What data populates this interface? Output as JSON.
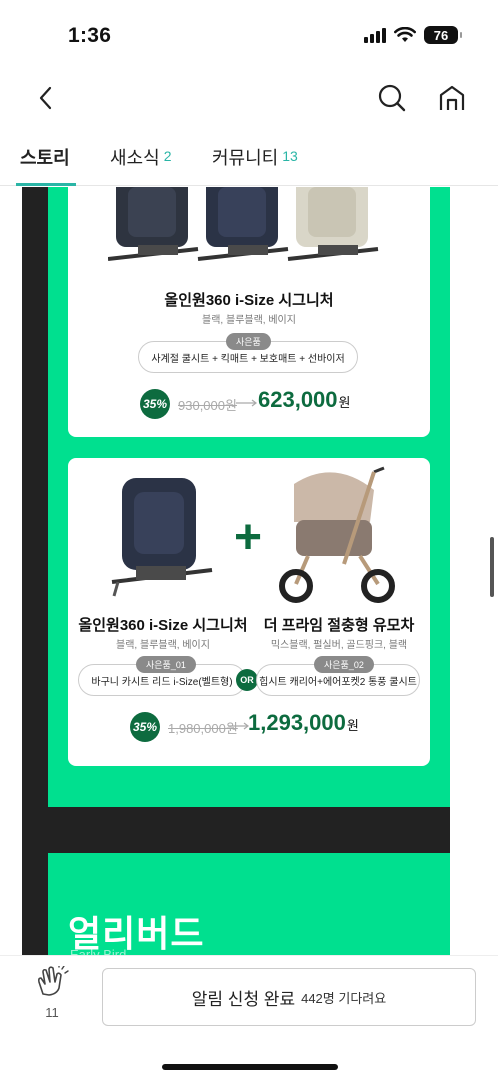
{
  "status_bar": {
    "time": "1:36",
    "battery": "76"
  },
  "nav": {
    "back_icon": "chevron-left-icon",
    "search_icon": "search-icon",
    "home_icon": "home-icon"
  },
  "tabs": [
    {
      "label": "스토리",
      "count": ""
    },
    {
      "label": "새소식",
      "count": "2"
    },
    {
      "label": "커뮤니티",
      "count": "13"
    }
  ],
  "card1": {
    "title": "올인원360 i-Size 시그니처",
    "colors": "블랙, 블루블랙, 베이지",
    "gift_tag": "사은품",
    "gift": "사계절 쿨시트 + 킥매트 + 보호매트 + 선바이저",
    "discount": "35%",
    "original_price": "930,000원",
    "sale_price": "623,000",
    "won": "원"
  },
  "card2": {
    "left_title": "올인원360 i-Size 시그니처",
    "left_colors": "블랙, 블루블랙, 베이지",
    "right_title": "더 프라임 절충형 유모차",
    "right_colors": "믹스블랙, 펄실버, 골드핑크, 블랙",
    "gift1_tag": "사은품_01",
    "gift1": "바구니 카시트 리드 i-Size(벨트형)",
    "or_label": "OR",
    "gift2_tag": "사은품_02",
    "gift2": "힙시트 캐리어+에어포켓2 통풍 쿨시트",
    "discount": "35%",
    "original_price": "1,980,000원",
    "sale_price": "1,293,000",
    "won": "원",
    "plus": "+"
  },
  "early_bird": {
    "title": "얼리버드",
    "subtitle": "Early Bird"
  },
  "bottom": {
    "clap_count": "11",
    "notify_label": "알림 신청 완료",
    "waiting": "442명 기다려요"
  },
  "colors": {
    "accent_green": "#00e08f",
    "dark_green": "#0d6b3f",
    "teal": "#2ab5a6"
  }
}
